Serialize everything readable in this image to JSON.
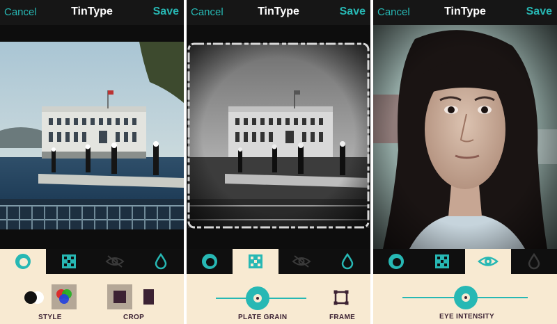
{
  "app": {
    "title": "TinType",
    "cancel_label": "Cancel",
    "save_label": "Save"
  },
  "screens": [
    {
      "active_tab": "style",
      "tabs": [
        "style-icon",
        "plate-grain-icon",
        "eye-off-icon",
        "drop-icon"
      ],
      "controls": {
        "style_label": "STYLE",
        "crop_label": "CROP"
      }
    },
    {
      "active_tab": "plate-grain",
      "tabs": [
        "style-icon",
        "plate-grain-icon",
        "eye-off-icon",
        "drop-icon"
      ],
      "controls": {
        "plate_grain_label": "PLATE GRAIN",
        "plate_grain_value": 0.5,
        "frame_label": "FRAME"
      }
    },
    {
      "active_tab": "eye",
      "tabs": [
        "style-icon",
        "plate-grain-icon",
        "eye-icon",
        "drop-icon"
      ],
      "controls": {
        "eye_intensity_label": "EYE INTENSITY",
        "eye_intensity_value": 0.52
      }
    }
  ],
  "colors": {
    "accent": "#27b8b4",
    "panel": "#f8ead2",
    "dark": "#3c2233",
    "bar": "#161616"
  }
}
